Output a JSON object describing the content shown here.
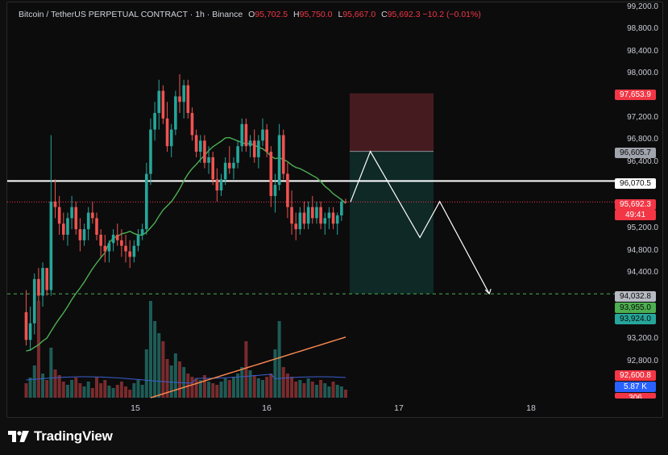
{
  "legend": {
    "symbol": "Bitcoin / TetherUS PERPETUAL CONTRACT · 1h · Binance",
    "o_key": "O",
    "o_val": "95,702.5",
    "h_key": "H",
    "h_val": "95,750.0",
    "l_key": "L",
    "l_val": "95,667.0",
    "c_key": "C",
    "c_val": "95,692.3",
    "change": "−10.2 (−0.01%)"
  },
  "price_axis": [
    "99,200.0",
    "98,800.0",
    "98,400.0",
    "98,000.0",
    "97,200.0",
    "96,800.0",
    "96,400.0",
    "95,200.0",
    "94,800.0",
    "94,400.0",
    "93,200.0",
    "92,800.0"
  ],
  "tags": {
    "stop": "97,653.9",
    "entry": "96,605.7",
    "level": "96,070.5",
    "last_price": "95,692.3",
    "countdown": "49:41",
    "target": "94,032.8",
    "green1": "93,955.0",
    "green2": "93,924.0",
    "ma_val": "92,600.8",
    "volume": "5.87 K",
    "partial": "306"
  },
  "time_axis": [
    "15",
    "16",
    "17",
    "18"
  ],
  "brand": "TradingView",
  "colors": {
    "up": "#26a69a",
    "down": "#ef5350",
    "ma": "#4caf50",
    "vol_ma": "#ff8a50",
    "vol_ma2": "#3b5fd0",
    "stop_zone": "#4a1c22",
    "target_zone": "#0f2b28"
  },
  "chart_data": {
    "type": "candlestick",
    "timeframe": "1h",
    "x_ticks": [
      "15",
      "16",
      "17",
      "18"
    ],
    "ylim": [
      92500,
      99300
    ],
    "levels": {
      "horizontal": 96070.5,
      "dashed_target": 94032.8,
      "last": 95692.3
    },
    "position": {
      "stop": 97653.9,
      "entry": 96605.7,
      "target": 94032.8
    },
    "projection": [
      {
        "t": 0,
        "p": 95692.3
      },
      {
        "t": 4,
        "p": 96605.7
      },
      {
        "t": 14,
        "p": 95050
      },
      {
        "t": 18,
        "p": 95700
      },
      {
        "t": 28,
        "p": 94032.8
      }
    ],
    "candles": [
      [
        93700,
        94100,
        93100,
        93200
      ],
      [
        93200,
        93800,
        93000,
        93500
      ],
      [
        93500,
        94400,
        93300,
        94300
      ],
      [
        94300,
        94500,
        93900,
        94000
      ],
      [
        94000,
        94600,
        93800,
        94500
      ],
      [
        94500,
        94500,
        94000,
        94100
      ],
      [
        94100,
        96900,
        94000,
        95700
      ],
      [
        95700,
        96100,
        95400,
        95600
      ],
      [
        95600,
        95800,
        95100,
        95300
      ],
      [
        95300,
        95500,
        95000,
        95100
      ],
      [
        95100,
        95500,
        94900,
        95400
      ],
      [
        95400,
        95800,
        95200,
        95600
      ],
      [
        95600,
        95700,
        95100,
        95200
      ],
      [
        95200,
        95400,
        94800,
        95000
      ],
      [
        95000,
        95300,
        94900,
        95200
      ],
      [
        95200,
        95600,
        95000,
        95500
      ],
      [
        95500,
        95700,
        95300,
        95400
      ],
      [
        95400,
        95500,
        95000,
        95100
      ],
      [
        95100,
        95200,
        94700,
        94900
      ],
      [
        94900,
        95100,
        94600,
        94800
      ],
      [
        94800,
        95000,
        94600,
        94950
      ],
      [
        94950,
        95200,
        94800,
        95100
      ],
      [
        95100,
        95300,
        94900,
        95000
      ],
      [
        95000,
        95200,
        94700,
        94900
      ],
      [
        94900,
        95100,
        94600,
        94800
      ],
      [
        94800,
        95000,
        94500,
        94700
      ],
      [
        94700,
        95000,
        94600,
        94900
      ],
      [
        94900,
        95200,
        94800,
        95100
      ],
      [
        95100,
        95300,
        95000,
        95200
      ],
      [
        95200,
        96400,
        95100,
        96200
      ],
      [
        96200,
        97200,
        96000,
        97000
      ],
      [
        97000,
        97500,
        96800,
        97300
      ],
      [
        97300,
        97900,
        97000,
        97700
      ],
      [
        97700,
        97800,
        97100,
        97200
      ],
      [
        97200,
        97500,
        96600,
        96700
      ],
      [
        96700,
        97100,
        96500,
        97000
      ],
      [
        97000,
        97700,
        96900,
        97600
      ],
      [
        97600,
        98000,
        97300,
        97500
      ],
      [
        97500,
        97900,
        97200,
        97800
      ],
      [
        97800,
        97900,
        97200,
        97300
      ],
      [
        97300,
        97400,
        96800,
        96900
      ],
      [
        96900,
        97000,
        96500,
        96600
      ],
      [
        96600,
        96900,
        96400,
        96800
      ],
      [
        96800,
        96900,
        96300,
        96400
      ],
      [
        96400,
        96700,
        96200,
        96500
      ],
      [
        96500,
        96600,
        96000,
        96100
      ],
      [
        96100,
        96300,
        95700,
        95900
      ],
      [
        95900,
        96200,
        95800,
        96100
      ],
      [
        96100,
        96500,
        96000,
        96400
      ],
      [
        96400,
        96700,
        96200,
        96300
      ],
      [
        96300,
        96500,
        96100,
        96400
      ],
      [
        96400,
        96800,
        96300,
        96700
      ],
      [
        96700,
        97200,
        96600,
        97100
      ],
      [
        97100,
        97200,
        96600,
        96700
      ],
      [
        96700,
        96900,
        96500,
        96800
      ],
      [
        96800,
        97000,
        96400,
        96500
      ],
      [
        96500,
        96900,
        96300,
        96800
      ],
      [
        96800,
        97200,
        96700,
        97000
      ],
      [
        97000,
        97100,
        96500,
        96600
      ],
      [
        96600,
        96700,
        95600,
        95800
      ],
      [
        95800,
        96200,
        95500,
        96000
      ],
      [
        96000,
        97100,
        95900,
        96900
      ],
      [
        96900,
        97000,
        96100,
        96200
      ],
      [
        96200,
        96400,
        95400,
        95600
      ],
      [
        95600,
        95900,
        95100,
        95300
      ],
      [
        95300,
        95500,
        95000,
        95200
      ],
      [
        95200,
        95600,
        95100,
        95500
      ],
      [
        95500,
        95700,
        95200,
        95300
      ],
      [
        95300,
        95700,
        95200,
        95600
      ],
      [
        95600,
        95800,
        95300,
        95400
      ],
      [
        95400,
        95700,
        95300,
        95600
      ],
      [
        95600,
        95700,
        95200,
        95300
      ],
      [
        95300,
        95500,
        95100,
        95400
      ],
      [
        95400,
        95600,
        95200,
        95500
      ],
      [
        95500,
        95600,
        95200,
        95300
      ],
      [
        95300,
        95500,
        95100,
        95450
      ],
      [
        95450,
        95750,
        95350,
        95700
      ],
      [
        95700,
        95750,
        95667,
        95692.3
      ]
    ]
  }
}
